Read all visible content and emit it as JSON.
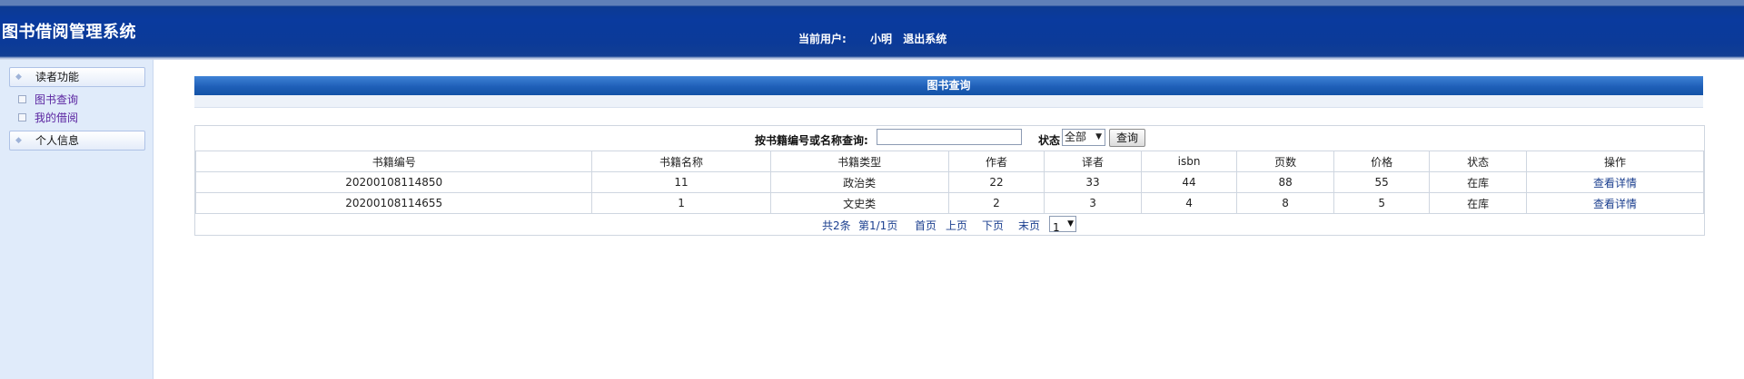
{
  "header": {
    "app_title": "图书借阅管理系统",
    "current_user_label": "当前用户:",
    "username": "小明",
    "logout_label": "退出系统"
  },
  "sidebar": {
    "groups": [
      {
        "label": "读者功能"
      },
      {
        "label": "个人信息"
      }
    ],
    "items": [
      {
        "label": "图书查询"
      },
      {
        "label": "我的借阅"
      }
    ]
  },
  "main": {
    "title": "图书查询",
    "search": {
      "label": "按书籍编号或名称查询:",
      "input_value": "",
      "input_placeholder": "",
      "status_label": "状态",
      "status_selected": "全部",
      "query_button": "查询"
    },
    "table": {
      "columns": [
        "书籍编号",
        "书籍名称",
        "书籍类型",
        "作者",
        "译者",
        "isbn",
        "页数",
        "价格",
        "状态",
        "操作"
      ],
      "rows": [
        [
          "20200108114850",
          "11",
          "政治类",
          "22",
          "33",
          "44",
          "88",
          "55",
          "在库",
          "查看详情"
        ],
        [
          "20200108114655",
          "1",
          "文史类",
          "2",
          "3",
          "4",
          "8",
          "5",
          "在库",
          "查看详情"
        ]
      ]
    },
    "pager": {
      "total": "共2条",
      "page_info": "第1/1页",
      "first": "首页",
      "prev": "上页",
      "next": "下页",
      "last": "末页",
      "page_selected": "1"
    }
  },
  "colors": {
    "header_blue": "#0a3a9e",
    "title_bar_blue": "#1f5fb8",
    "sidebar_bg": "#e0ebfa",
    "link_color": "#1b3f8f",
    "menu_item_color": "#5a24a0"
  },
  "icons": {
    "menu_group": "diamond-bullet-icon",
    "menu_item": "square-bullet-icon",
    "dropdown": "dropdown-arrow-icon"
  }
}
